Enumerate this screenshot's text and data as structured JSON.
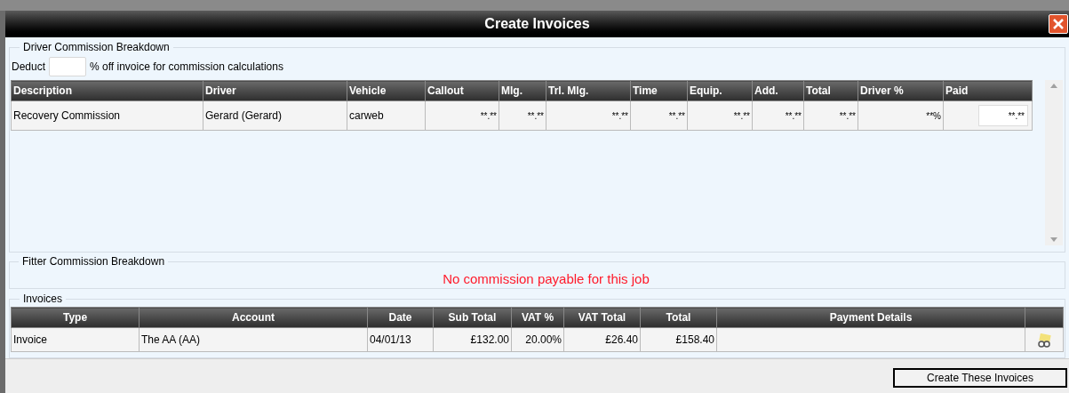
{
  "window": {
    "title": "Create Invoices"
  },
  "driver_commission": {
    "legend": "Driver Commission Breakdown",
    "deduct_label": "Deduct",
    "deduct_suffix": "% off invoice for commission calculations",
    "columns": [
      "Description",
      "Driver",
      "Vehicle",
      "Callout",
      "Mlg.",
      "Trl. Mlg.",
      "Time",
      "Equip.",
      "Add.",
      "Total",
      "Driver %",
      "Paid"
    ],
    "rows": [
      {
        "cells": [
          "Recovery Commission",
          "Gerard (Gerard)",
          "carweb",
          "**.**",
          "**.**",
          "**.**",
          "**.**",
          "**.**",
          "**.**",
          "**.**",
          "**%"
        ],
        "paid": "**.**"
      }
    ]
  },
  "fitter_commission": {
    "legend": "Fitter Commission Breakdown",
    "message": "No commission payable for this job"
  },
  "invoices": {
    "legend": "Invoices",
    "columns": [
      "Type",
      "Account",
      "Date",
      "Sub Total",
      "VAT %",
      "VAT Total",
      "Total",
      "Payment Details"
    ],
    "rows": [
      {
        "cells": [
          "Invoice",
          "The AA (AA)",
          "04/01/13",
          "£132.00",
          "20.00%",
          "£26.40",
          "£158.40",
          ""
        ]
      }
    ]
  },
  "buttons": [
    "Create These Invoices"
  ]
}
